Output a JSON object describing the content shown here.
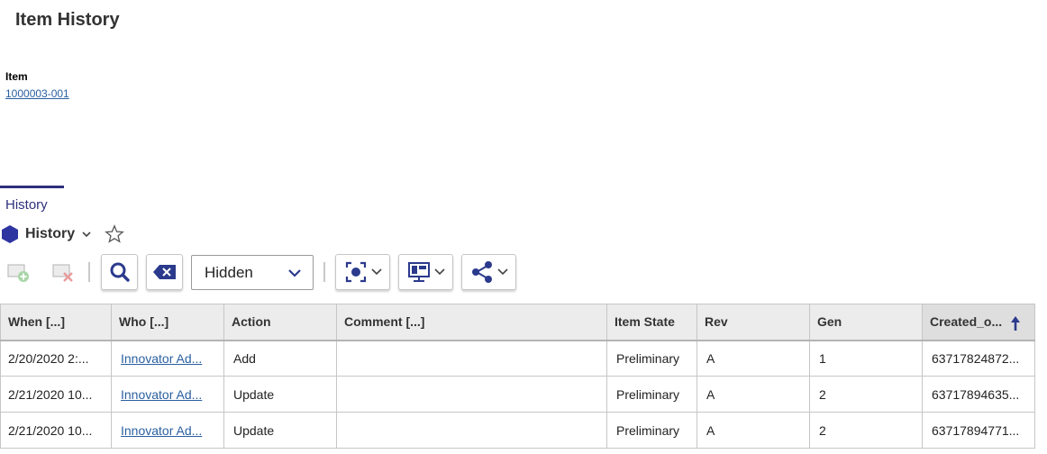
{
  "page": {
    "title": "Item History"
  },
  "item": {
    "label": "Item",
    "value": "1000003-001"
  },
  "tab": {
    "label": "History"
  },
  "grid": {
    "title": "History",
    "filter_select": {
      "value": "Hidden"
    },
    "columns": [
      "When [...]",
      "Who [...]",
      "Action",
      "Comment [...]",
      "Item State",
      "Rev",
      "Gen",
      "Created_o..."
    ],
    "sorted_column": "Created_o...",
    "sort_direction": "ascending",
    "rows": [
      {
        "when": "2/20/2020 2:...",
        "who": "Innovator Ad...",
        "action": "Add",
        "comment": "",
        "state": "Preliminary",
        "rev": "A",
        "gen": "1",
        "created": "63717824872..."
      },
      {
        "when": "2/21/2020 10...",
        "who": "Innovator Ad...",
        "action": "Update",
        "comment": "",
        "state": "Preliminary",
        "rev": "A",
        "gen": "2",
        "created": "63717894635..."
      },
      {
        "when": "2/21/2020 10...",
        "who": "Innovator Ad...",
        "action": "Update",
        "comment": "",
        "state": "Preliminary",
        "rev": "A",
        "gen": "2",
        "created": "63717894771..."
      }
    ]
  },
  "colors": {
    "accent": "#2f2f7c",
    "link": "#2a5fa0",
    "header_bg": "#ececec"
  },
  "icons": [
    "hexagon-icon",
    "chevron-down-icon",
    "star-icon",
    "new-item-icon",
    "delete-item-icon",
    "search-icon",
    "clear-search-icon",
    "screenshot-icon",
    "layout-icon",
    "share-icon",
    "sort-ascending-icon"
  ]
}
